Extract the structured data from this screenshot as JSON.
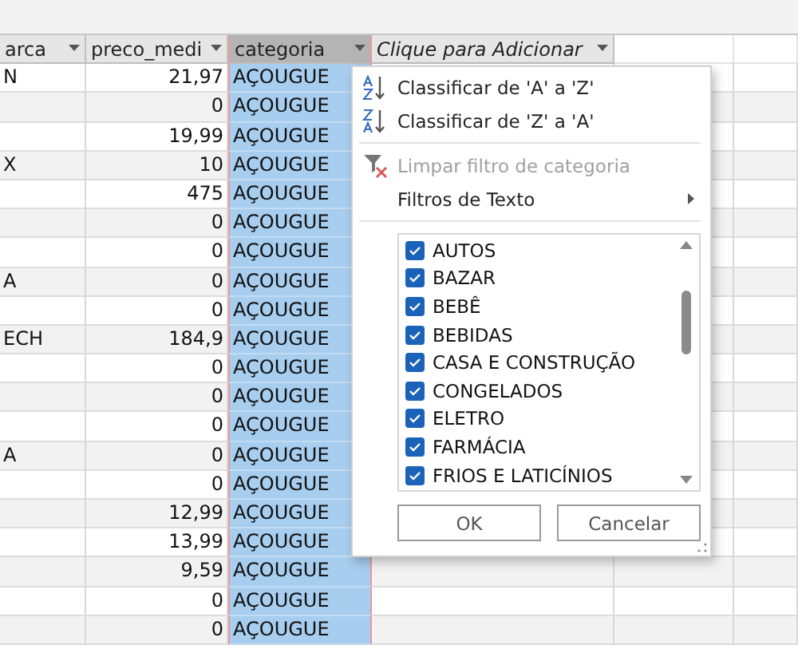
{
  "table": {
    "columns": [
      {
        "label": "arca",
        "selected": false,
        "kind": "field"
      },
      {
        "label": "preco_medi",
        "selected": false,
        "kind": "field"
      },
      {
        "label": "categoria",
        "selected": true,
        "kind": "field"
      },
      {
        "label": "Clique para Adicionar",
        "selected": false,
        "kind": "add-column"
      }
    ],
    "rows": [
      [
        "N",
        "21,97",
        "AÇOUGUE"
      ],
      [
        "",
        "0",
        "AÇOUGUE"
      ],
      [
        "",
        "19,99",
        "AÇOUGUE"
      ],
      [
        "X",
        "10",
        "AÇOUGUE"
      ],
      [
        "",
        "475",
        "AÇOUGUE"
      ],
      [
        "",
        "0",
        "AÇOUGUE"
      ],
      [
        "",
        "0",
        "AÇOUGUE"
      ],
      [
        "A",
        "0",
        "AÇOUGUE"
      ],
      [
        "",
        "0",
        "AÇOUGUE"
      ],
      [
        "ECH",
        "184,9",
        "AÇOUGUE"
      ],
      [
        "",
        "0",
        "AÇOUGUE"
      ],
      [
        "",
        "0",
        "AÇOUGUE"
      ],
      [
        "",
        "0",
        "AÇOUGUE"
      ],
      [
        "A",
        "0",
        "AÇOUGUE"
      ],
      [
        "",
        "0",
        "AÇOUGUE"
      ],
      [
        "",
        "12,99",
        "AÇOUGUE"
      ],
      [
        "",
        "13,99",
        "AÇOUGUE"
      ],
      [
        "",
        "9,59",
        "AÇOUGUE"
      ],
      [
        "",
        "0",
        "AÇOUGUE"
      ],
      [
        "",
        "0",
        "AÇOUGUE"
      ]
    ]
  },
  "filter_menu": {
    "commands": [
      {
        "kind": "sort-asc",
        "label": "Classificar de 'A' a 'Z'",
        "disabled": false
      },
      {
        "kind": "sort-desc",
        "label": "Classificar de 'Z' a 'A'",
        "disabled": false
      },
      {
        "kind": "clear",
        "label": "Limpar filtro de categoria",
        "disabled": true
      },
      {
        "kind": "submenu",
        "label": "Filtros de Texto",
        "disabled": false
      }
    ],
    "values": [
      {
        "label": "AUTOS",
        "checked": true
      },
      {
        "label": "BAZAR",
        "checked": true
      },
      {
        "label": "BEBÊ",
        "checked": true
      },
      {
        "label": "BEBIDAS",
        "checked": true
      },
      {
        "label": "CASA E CONSTRUÇÃO",
        "checked": true
      },
      {
        "label": "CONGELADOS",
        "checked": true
      },
      {
        "label": "ELETRO",
        "checked": true
      },
      {
        "label": "FARMÁCIA",
        "checked": true
      },
      {
        "label": "FRIOS E LATICÍNIOS",
        "checked": true
      }
    ],
    "buttons": [
      "OK",
      "Cancelar"
    ]
  }
}
